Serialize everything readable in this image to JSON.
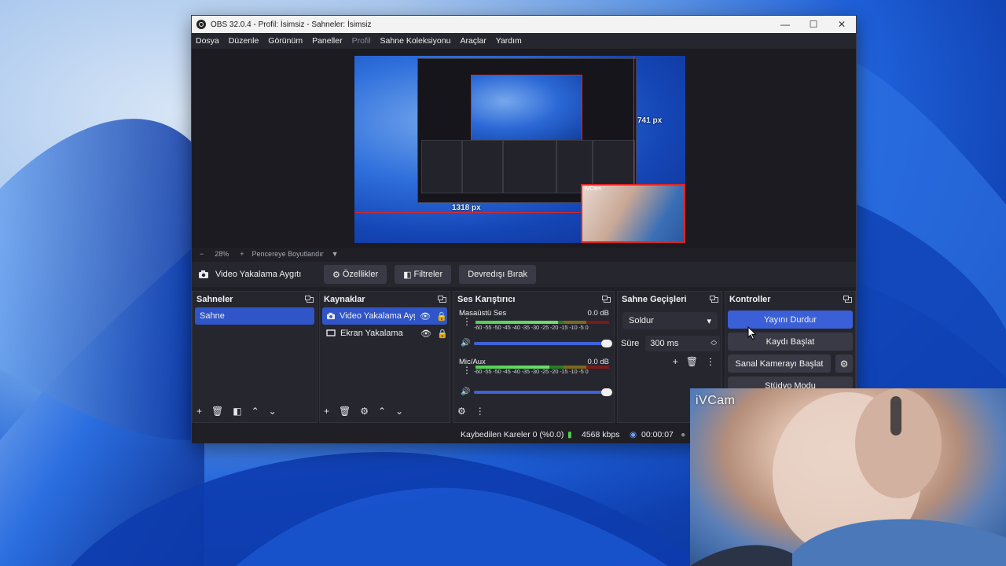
{
  "window": {
    "title": "OBS 32.0.4 - Profil: İsimsiz - Sahneler: İsimsiz",
    "min_icon": "minimize-icon",
    "max_icon": "maximize-icon",
    "close_icon": "close-icon"
  },
  "menu": {
    "items": [
      "Dosya",
      "Düzenle",
      "Görünüm",
      "Paneller",
      "Profil",
      "Sahne Koleksiyonu",
      "Araçlar",
      "Yardım"
    ],
    "disabled": [
      "Profil"
    ]
  },
  "preview": {
    "width_label": "741 px",
    "height_label": "1318 px",
    "cam_label": "iVCam"
  },
  "zoombar": {
    "minus": "−",
    "zoom": "28%",
    "plus": "+",
    "fit": "Pencereye Boyutlandır"
  },
  "propbar": {
    "source_name": "Video Yakalama Aygıtı",
    "properties": "Özellikler",
    "filters": "Filtreler",
    "deactivate": "Devredışı Bırak"
  },
  "scenes": {
    "title": "Sahneler",
    "items": [
      "Sahne"
    ]
  },
  "sources": {
    "title": "Kaynaklar",
    "items": [
      {
        "label": "Video Yakalama Aygı",
        "icon": "camera-icon",
        "selected": true
      },
      {
        "label": "Ekran Yakalama",
        "icon": "monitor-icon",
        "selected": false
      }
    ]
  },
  "mixer": {
    "title": "Ses Karıştırıcı",
    "channels": [
      {
        "name": "Masaüstü Ses",
        "db": "0.0 dB",
        "level": 0.62
      },
      {
        "name": "Mic/Aux",
        "db": "0.0 dB",
        "level": 0.55
      }
    ],
    "scale": "-60 -55 -50 -45 -40 -35 -30 -25 -20 -15 -10 -5 0"
  },
  "transitions": {
    "title": "Sahne Geçişleri",
    "selected": "Soldur",
    "duration_label": "Süre",
    "duration_value": "300 ms"
  },
  "controls": {
    "title": "Kontroller",
    "stop_stream": "Yayını Durdur",
    "start_record": "Kaydı Başlat",
    "virtual_cam": "Sanal Kamerayı Başlat",
    "studio_mode": "Stüdyo Modu"
  },
  "status": {
    "dropped": "Kaybedilen Kareler 0 (%0.0)",
    "bitrate": "4568 kbps",
    "stream_time": "00:00:07"
  },
  "ivcam": {
    "label": "iVCam"
  },
  "colors": {
    "accent": "#3b5fd6",
    "selection": "#2f55c8",
    "bounding_box": "#e02424",
    "panel": "#26262e"
  }
}
